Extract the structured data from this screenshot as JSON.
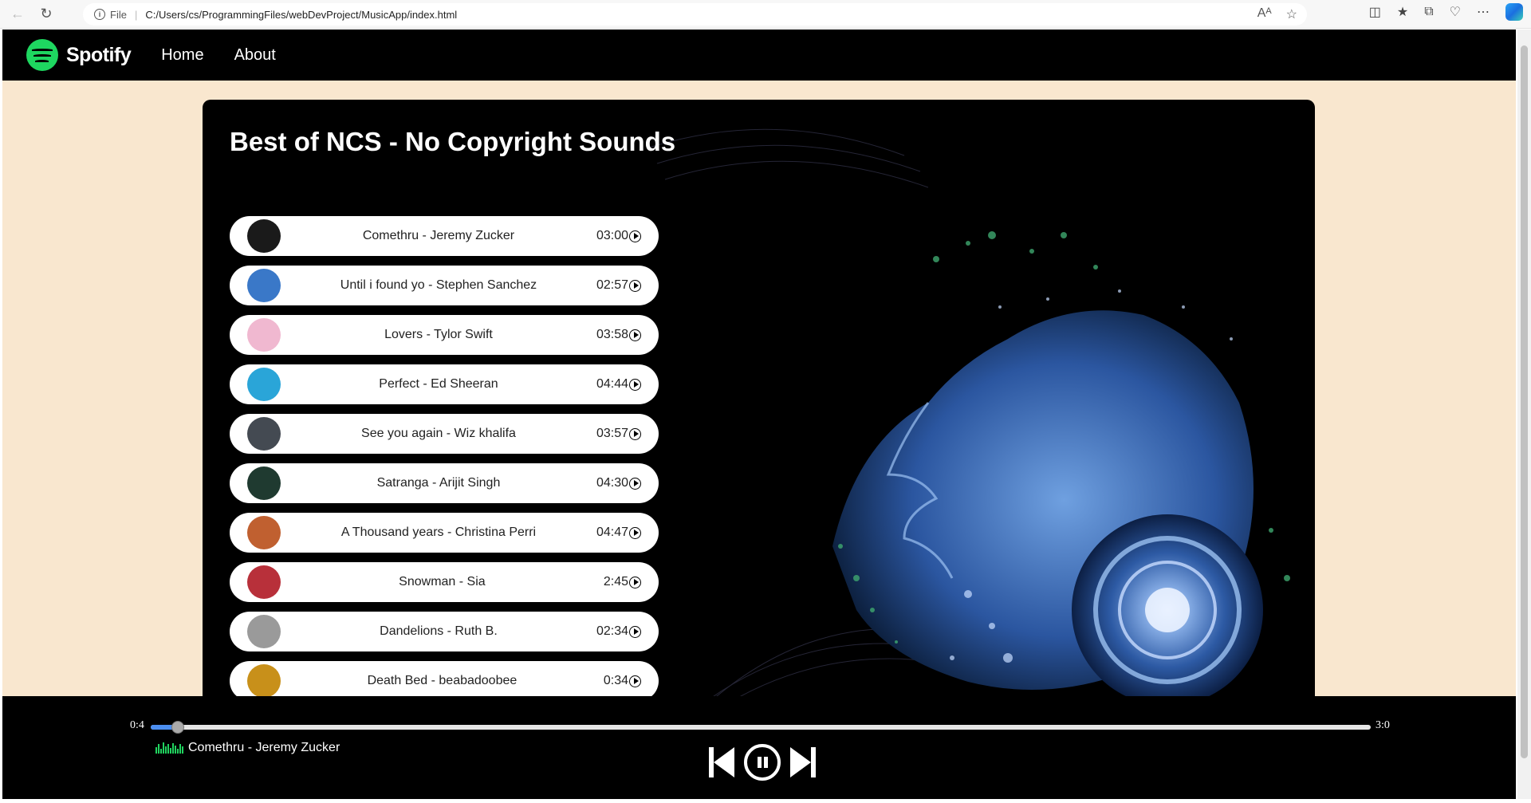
{
  "browser": {
    "file_label": "File",
    "url": "C:/Users/cs/ProgrammingFiles/webDevProject/MusicApp/index.html"
  },
  "navbar": {
    "brand": "Spotify",
    "links": [
      "Home",
      "About"
    ],
    "brand_color": "#1ed760"
  },
  "main": {
    "title": "Best of NCS - No Copyright Sounds",
    "songs": [
      {
        "name": "Comethru - Jeremy Zucker",
        "duration": "03:00",
        "cover_color": "#1a1a1a"
      },
      {
        "name": "Until i found yo - Stephen Sanchez",
        "duration": "02:57",
        "cover_color": "#3a78c8"
      },
      {
        "name": "Lovers - Tylor Swift",
        "duration": "03:58",
        "cover_color": "#f0b8d0"
      },
      {
        "name": "Perfect - Ed Sheeran",
        "duration": "04:44",
        "cover_color": "#2aa5d8"
      },
      {
        "name": "See you again - Wiz khalifa",
        "duration": "03:57",
        "cover_color": "#444a52"
      },
      {
        "name": "Satranga - Arijit Singh",
        "duration": "04:30",
        "cover_color": "#1f3a30"
      },
      {
        "name": "A Thousand years - Christina Perri",
        "duration": "04:47",
        "cover_color": "#c06030"
      },
      {
        "name": "Snowman - Sia",
        "duration": "2:45",
        "cover_color": "#b8303a"
      },
      {
        "name": "Dandelions - Ruth B.",
        "duration": "02:34",
        "cover_color": "#9a9a9a"
      },
      {
        "name": "Death Bed - beabadoobee",
        "duration": "0:34",
        "cover_color": "#c8901a"
      }
    ]
  },
  "player": {
    "current_time": "0:4",
    "total_time": "3:0",
    "progress_fraction": 0.022,
    "now_playing": "Comethru - Jeremy Zucker",
    "accent": "#21d35f"
  }
}
